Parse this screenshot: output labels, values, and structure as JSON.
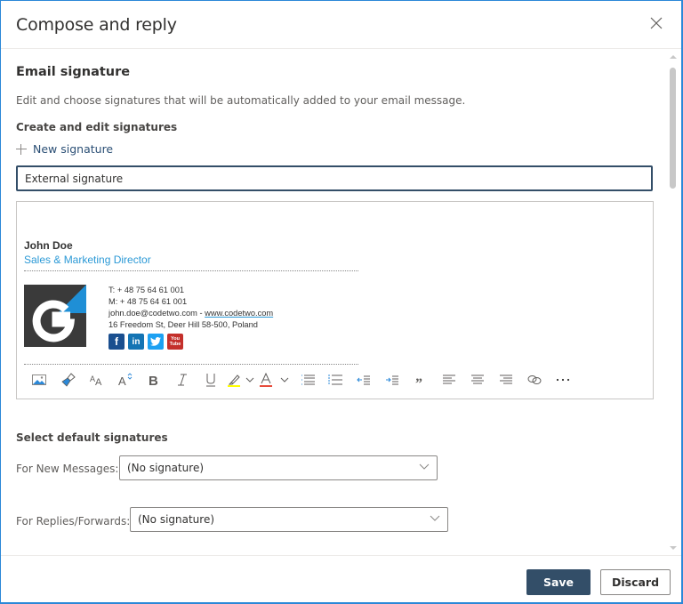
{
  "dialog": {
    "title": "Compose and reply",
    "close_icon": "close-icon"
  },
  "email_signature": {
    "section_title": "Email signature",
    "description": "Edit and choose signatures that will be automatically added to your email message.",
    "create_edit_label": "Create and edit signatures",
    "new_signature_label": "New signature",
    "signature_name_value": "External signature"
  },
  "signature": {
    "name": "John Doe",
    "role": "Sales & Marketing Director",
    "phone": "T: + 48 75 64 61 001",
    "mobile": "M: + 48 75 64 61 001",
    "email": "john.doe@codetwo.com",
    "separator": " - ",
    "website": "www.codetwo.com",
    "address": "16 Freedom St, Deer Hill 58-500, Poland",
    "logo_letter": "G",
    "socials": [
      {
        "name": "facebook",
        "glyph": "f",
        "color": "#1a4f8f"
      },
      {
        "name": "linkedin",
        "glyph": "in",
        "color": "#1474b4"
      },
      {
        "name": "twitter",
        "glyph": "t",
        "color": "#1da1f2"
      },
      {
        "name": "youtube",
        "glyph": "You Tube",
        "color": "#c4302b"
      }
    ],
    "accent_color": "#2b99d6"
  },
  "toolbar": {
    "items": [
      "insert-image",
      "format-painter",
      "font-size",
      "grow-font",
      "bold",
      "italic",
      "underline",
      "highlight",
      "highlight-dropdown",
      "font-color",
      "font-color-dropdown",
      "bullets",
      "numbering",
      "decrease-indent",
      "increase-indent",
      "quote",
      "align-left",
      "align-center",
      "align-right",
      "insert-link",
      "more-options"
    ],
    "highlight_color": "#ffff00",
    "font_color": "#e74c3c"
  },
  "defaults": {
    "title": "Select default signatures",
    "new_messages_label": "For New Messages:",
    "new_messages_value": "(No signature)",
    "replies_label": "For Replies/Forwards:",
    "replies_value": "(No signature)"
  },
  "footer": {
    "save_label": "Save",
    "discard_label": "Discard"
  },
  "colors": {
    "primary": "#334e68",
    "link": "#2b4f75",
    "window_border": "#2b88d8"
  }
}
